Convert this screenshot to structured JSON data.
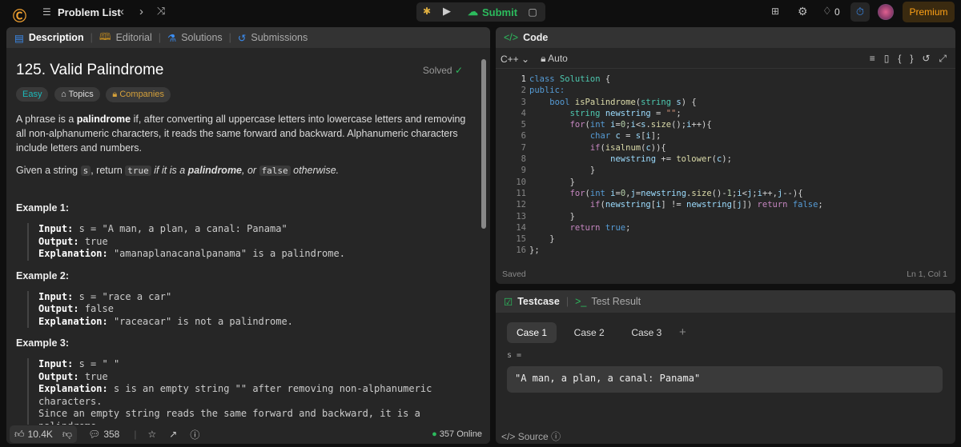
{
  "topbar": {
    "problem_list": "Problem List",
    "submit": "Submit",
    "streak": "0",
    "premium": "Premium"
  },
  "description": {
    "tabs": [
      "Description",
      "Editorial",
      "Solutions",
      "Submissions"
    ],
    "title": "125. Valid Palindrome",
    "solved": "Solved",
    "tags": [
      "Easy",
      "Topics",
      "Companies"
    ],
    "p1_a": "A phrase is a ",
    "p1_b": "palindrome",
    "p1_c": " if, after converting all uppercase letters into lowercase letters and removing all non-alphanumeric characters, it reads the same forward and backward. Alphanumeric characters include letters and numbers.",
    "p2_a": "Given a string ",
    "p2_s": "s",
    "p2_b": ", return ",
    "p2_true": "true",
    "p2_c": " if it is a ",
    "p2_d": "palindrome",
    "p2_e": ", or ",
    "p2_false": "false",
    "p2_f": " otherwise.",
    "examples": [
      {
        "title": "Example 1:",
        "input": "s = \"A man, a plan, a canal: Panama\"",
        "output": "true",
        "explanation": "\"amanaplanacanalpanama\" is a palindrome."
      },
      {
        "title": "Example 2:",
        "input": "s = \"race a car\"",
        "output": "false",
        "explanation": "\"raceacar\" is not a palindrome."
      },
      {
        "title": "Example 3:",
        "input": "s = \" \"",
        "output": "true",
        "explanation": "s is an empty string \"\" after removing non-alphanumeric characters.",
        "explanation2": "Since an empty string reads the same forward and backward, it is a palindrome."
      }
    ],
    "labels": {
      "input": "Input:",
      "output": "Output:",
      "explanation": "Explanation:"
    },
    "likes": "10.4K",
    "comments": "358",
    "online": "357 Online"
  },
  "code": {
    "title": "Code",
    "language": "C++",
    "mode": "Auto",
    "status": "Saved",
    "cursor": "Ln 1, Col 1",
    "lines": [
      [
        [
          "class ",
          "k"
        ],
        [
          "Solution",
          "t"
        ],
        [
          " {",
          "p"
        ]
      ],
      [
        [
          "public:",
          "k"
        ]
      ],
      [
        [
          "    bool ",
          "k"
        ],
        [
          "isPalindrome",
          "f"
        ],
        [
          "(",
          "p"
        ],
        [
          "string ",
          "t"
        ],
        [
          "s",
          "v"
        ],
        [
          ") {",
          "p"
        ]
      ],
      [
        [
          "        string ",
          "t"
        ],
        [
          "newstring",
          "v"
        ],
        [
          " = ",
          "p"
        ],
        [
          "\"\"",
          "s"
        ],
        [
          ";",
          "p"
        ]
      ],
      [
        [
          "        for",
          "c"
        ],
        [
          "(",
          "p"
        ],
        [
          "int ",
          "k"
        ],
        [
          "i",
          "v"
        ],
        [
          "=",
          "p"
        ],
        [
          "0",
          "n"
        ],
        [
          ";",
          "p"
        ],
        [
          "i",
          "v"
        ],
        [
          "<",
          "p"
        ],
        [
          "s",
          "v"
        ],
        [
          ".",
          "p"
        ],
        [
          "size",
          "f"
        ],
        [
          "();",
          "p"
        ],
        [
          "i",
          "v"
        ],
        [
          "++){",
          "p"
        ]
      ],
      [
        [
          "            char ",
          "k"
        ],
        [
          "c",
          "v"
        ],
        [
          " = ",
          "p"
        ],
        [
          "s",
          "v"
        ],
        [
          "[",
          "p"
        ],
        [
          "i",
          "v"
        ],
        [
          "];",
          "p"
        ]
      ],
      [
        [
          "            if",
          "c"
        ],
        [
          "(",
          "p"
        ],
        [
          "isalnum",
          "f"
        ],
        [
          "(",
          "p"
        ],
        [
          "c",
          "v"
        ],
        [
          ")){",
          "p"
        ]
      ],
      [
        [
          "                newstring",
          "v"
        ],
        [
          " += ",
          "p"
        ],
        [
          "tolower",
          "f"
        ],
        [
          "(",
          "p"
        ],
        [
          "c",
          "v"
        ],
        [
          ");",
          "p"
        ]
      ],
      [
        [
          "            }",
          "p"
        ]
      ],
      [
        [
          "        }",
          "p"
        ]
      ],
      [
        [
          "        for",
          "c"
        ],
        [
          "(",
          "p"
        ],
        [
          "int ",
          "k"
        ],
        [
          "i",
          "v"
        ],
        [
          "=",
          "p"
        ],
        [
          "0",
          "n"
        ],
        [
          ",",
          "p"
        ],
        [
          "j",
          "v"
        ],
        [
          "=",
          "p"
        ],
        [
          "newstring",
          "v"
        ],
        [
          ".",
          "p"
        ],
        [
          "size",
          "f"
        ],
        [
          "()-",
          "p"
        ],
        [
          "1",
          "n"
        ],
        [
          ";",
          "p"
        ],
        [
          "i",
          "v"
        ],
        [
          "<",
          "p"
        ],
        [
          "j",
          "v"
        ],
        [
          ";",
          "p"
        ],
        [
          "i",
          "v"
        ],
        [
          "++,",
          "p"
        ],
        [
          "j",
          "v"
        ],
        [
          "--){",
          "p"
        ]
      ],
      [
        [
          "            if",
          "c"
        ],
        [
          "(",
          "p"
        ],
        [
          "newstring",
          "v"
        ],
        [
          "[",
          "p"
        ],
        [
          "i",
          "v"
        ],
        [
          "] != ",
          "p"
        ],
        [
          "newstring",
          "v"
        ],
        [
          "[",
          "p"
        ],
        [
          "j",
          "v"
        ],
        [
          "]) ",
          "p"
        ],
        [
          "return ",
          "c"
        ],
        [
          "false",
          "k"
        ],
        [
          ";",
          "p"
        ]
      ],
      [
        [
          "        }",
          "p"
        ]
      ],
      [
        [
          "        return ",
          "c"
        ],
        [
          "true",
          "k"
        ],
        [
          ";",
          "p"
        ]
      ],
      [
        [
          "    }",
          "p"
        ]
      ],
      [
        [
          "};",
          "p"
        ]
      ]
    ]
  },
  "testcase": {
    "tabs": [
      "Testcase",
      "Test Result"
    ],
    "cases": [
      "Case 1",
      "Case 2",
      "Case 3"
    ],
    "var_label": "s =",
    "value": "\"A man, a plan, a canal: Panama\"",
    "source": "Source"
  }
}
